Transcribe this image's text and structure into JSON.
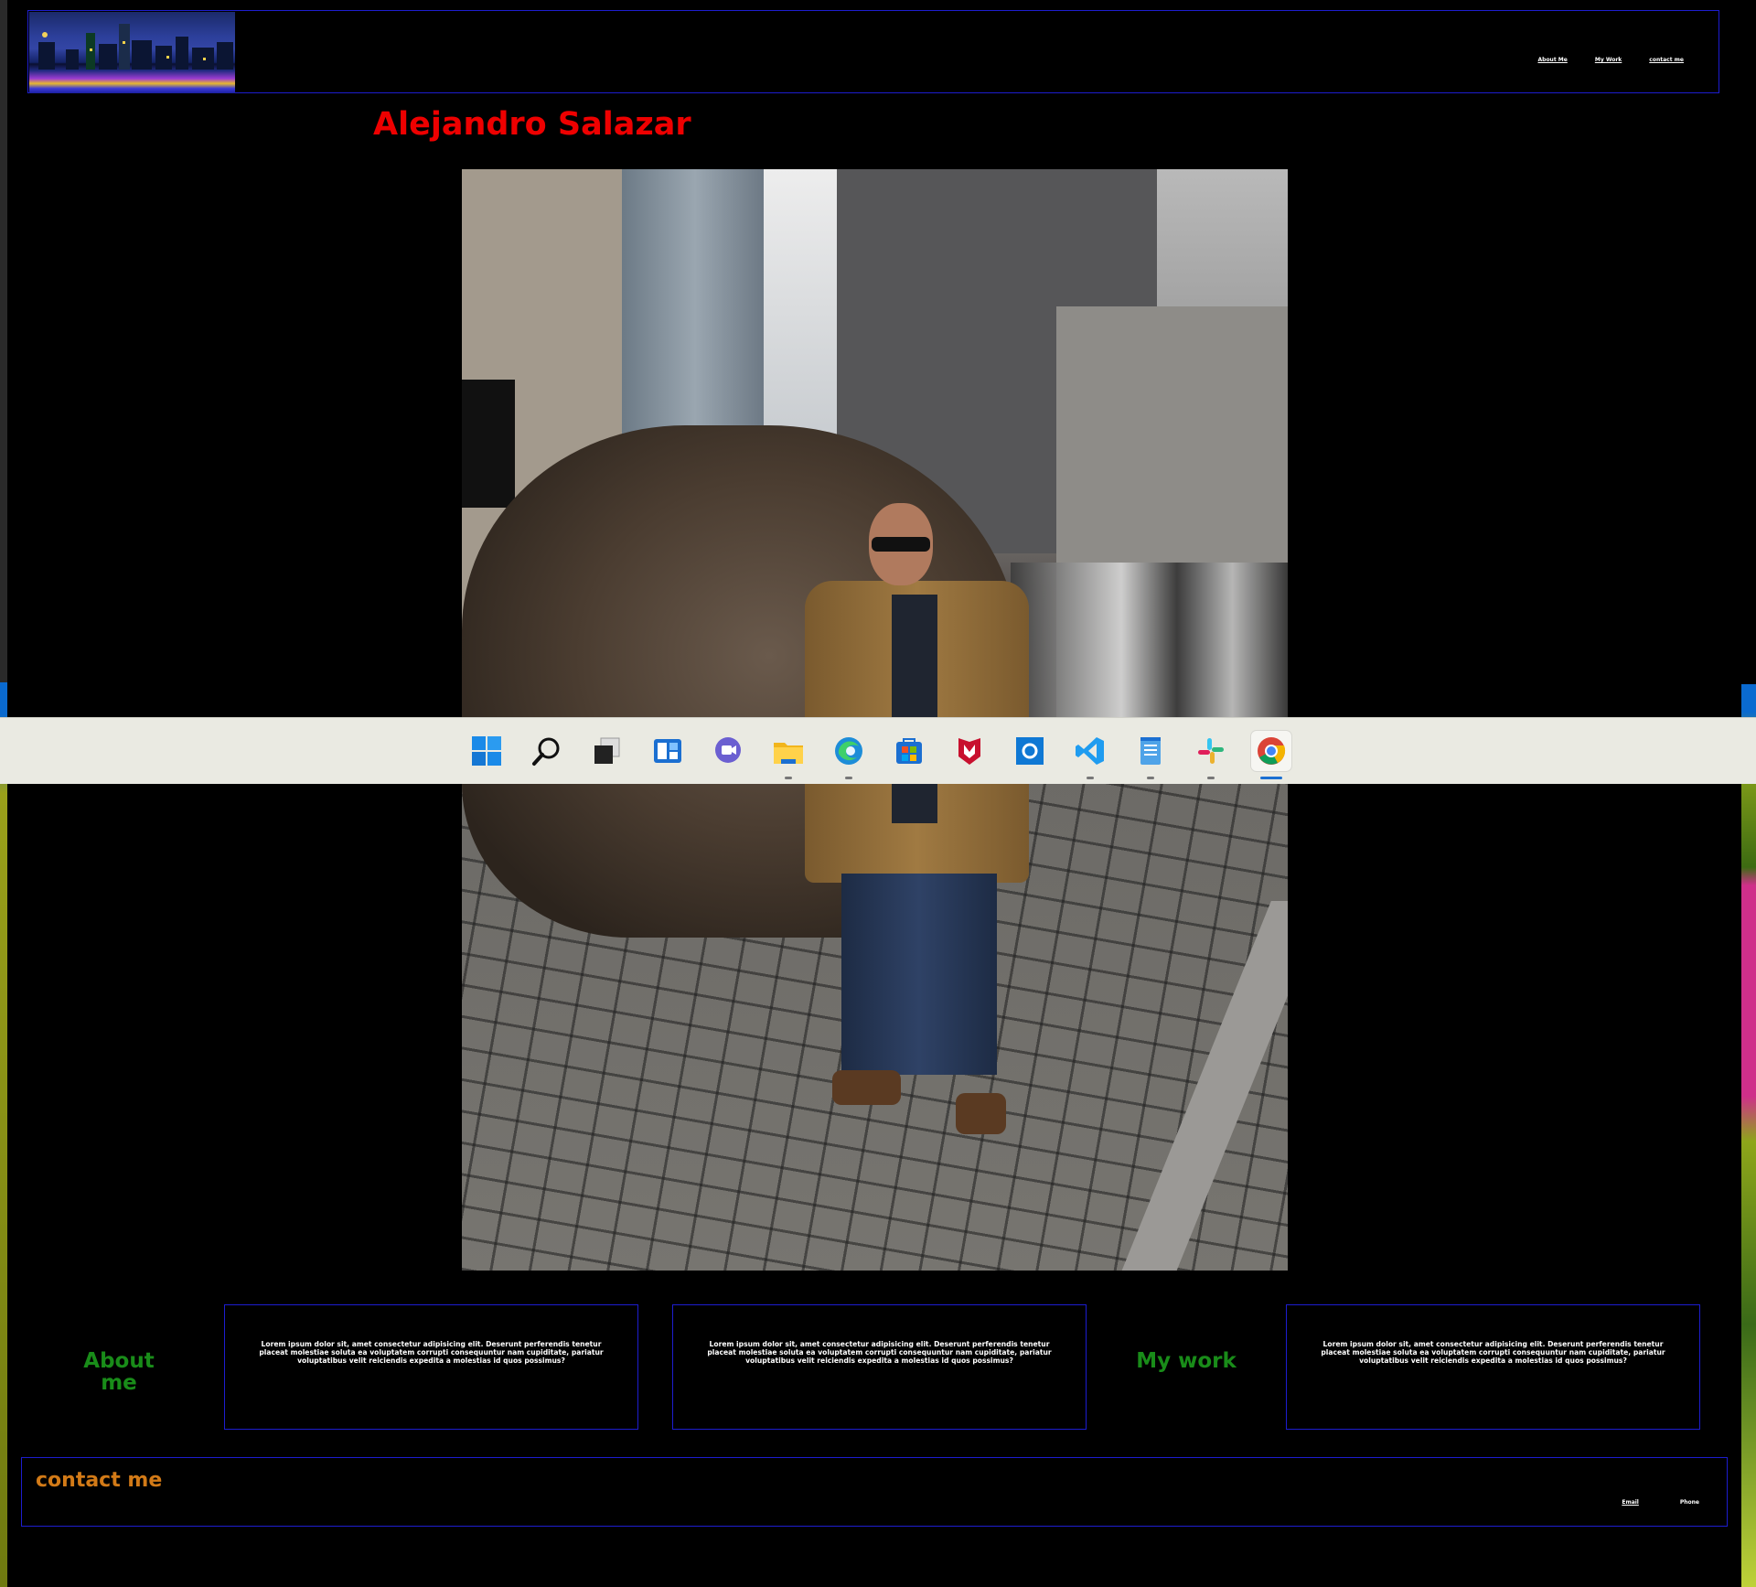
{
  "header": {
    "logo_alt": "Dallas skyline at night",
    "nav": [
      {
        "label": "About Me"
      },
      {
        "label": "My Work"
      },
      {
        "label": "contact me"
      }
    ]
  },
  "hero": {
    "name": "Alejandro Salazar",
    "photo_alt": "Person standing in front of the Charging Bull statue"
  },
  "sections": {
    "about_label": "About me",
    "work_label": "My work",
    "boxes": [
      {
        "text": "Lorem ipsum dolor sit, amet consectetur adipisicing elit. Deserunt perferendis tenetur placeat molestiae soluta ea voluptatem corrupti consequuntur nam cupiditate, pariatur voluptatibus velit reiciendis expedita a molestias id quos possimus?"
      },
      {
        "text": "Lorem ipsum dolor sit, amet consectetur adipisicing elit. Deserunt perferendis tenetur placeat molestiae soluta ea voluptatem corrupti consequuntur nam cupiditate, pariatur voluptatibus velit reiciendis expedita a molestias id quos possimus?"
      },
      {
        "text": "Lorem ipsum dolor sit, amet consectetur adipisicing elit. Deserunt perferendis tenetur placeat molestiae soluta ea voluptatem corrupti consequuntur nam cupiditate, pariatur voluptatibus velit reiciendis expedita a molestias id quos possimus?"
      }
    ]
  },
  "contact": {
    "title": "contact me",
    "email_label": "Email",
    "phone_label": "Phone"
  },
  "taskbar": {
    "icons": [
      {
        "name": "start-icon"
      },
      {
        "name": "search-icon"
      },
      {
        "name": "task-view-icon"
      },
      {
        "name": "widgets-icon"
      },
      {
        "name": "teams-chat-icon"
      },
      {
        "name": "file-explorer-icon"
      },
      {
        "name": "edge-icon"
      },
      {
        "name": "store-icon"
      },
      {
        "name": "mcafee-icon"
      },
      {
        "name": "cortana-icon"
      },
      {
        "name": "vscode-icon"
      },
      {
        "name": "notepad-icon"
      },
      {
        "name": "slack-icon"
      },
      {
        "name": "chrome-icon"
      }
    ]
  },
  "colors": {
    "background": "#000000",
    "border": "#1d1dcf",
    "name": "#ee0000",
    "section_label": "#198c19",
    "contact_title": "#d27a17"
  }
}
